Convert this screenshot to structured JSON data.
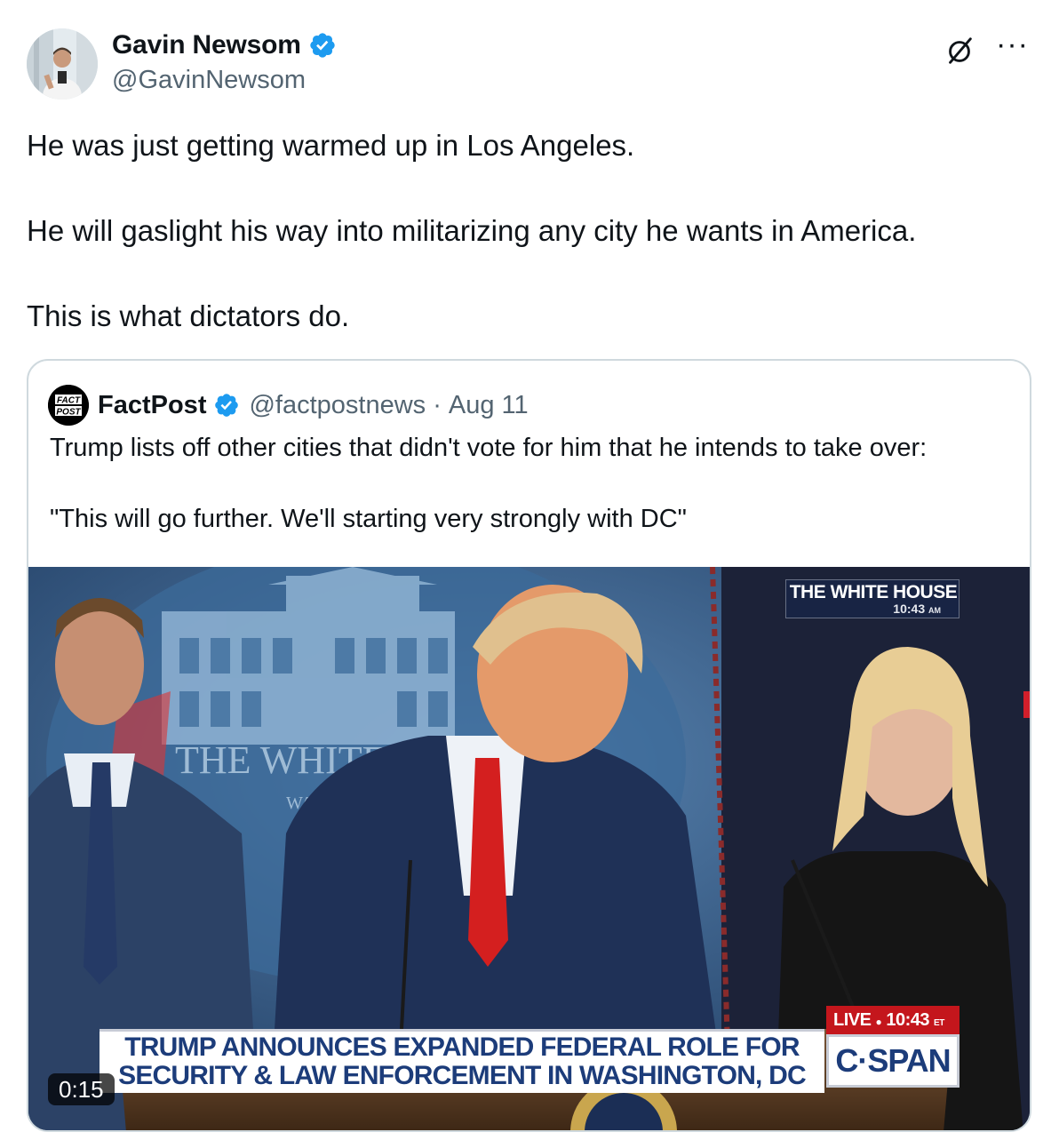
{
  "author": {
    "name": "Gavin Newsom",
    "handle": "@GavinNewsom",
    "verified_color": "#1d9bf0"
  },
  "actions": {
    "grok_icon": "grok-slash-circle-icon",
    "more_label": "···"
  },
  "tweet": {
    "paragraphs": [
      "He was just getting warmed up in Los Angeles.",
      "He will gaslight his way into militarizing any city he wants in America.",
      "This is what dictators do."
    ]
  },
  "quote": {
    "name": "FactPost",
    "handle": "@factpostnews",
    "separator": "·",
    "date": "Aug 11",
    "paragraphs": [
      "Trump lists off other cities that didn't vote for him that he intends to take over:",
      "\"This will go further. We'll starting very strongly with DC\""
    ],
    "avatar_text": [
      "FACT",
      "POST"
    ],
    "video": {
      "duration": "0:15",
      "bug_title": "THE WHITE HOUSE",
      "bug_time": "10:43",
      "bug_time_suffix": "AM",
      "chyron_line1": "TRUMP ANNOUNCES EXPANDED FEDERAL ROLE FOR",
      "chyron_line2": "SECURITY & LAW ENFORCEMENT IN WASHINGTON, DC",
      "live_label": "LIVE",
      "live_time": "10:43",
      "live_time_suffix": "ET",
      "network": "C·SPAN",
      "backdrop_text": "THE WHITE",
      "backdrop_subtext": "WA"
    }
  }
}
